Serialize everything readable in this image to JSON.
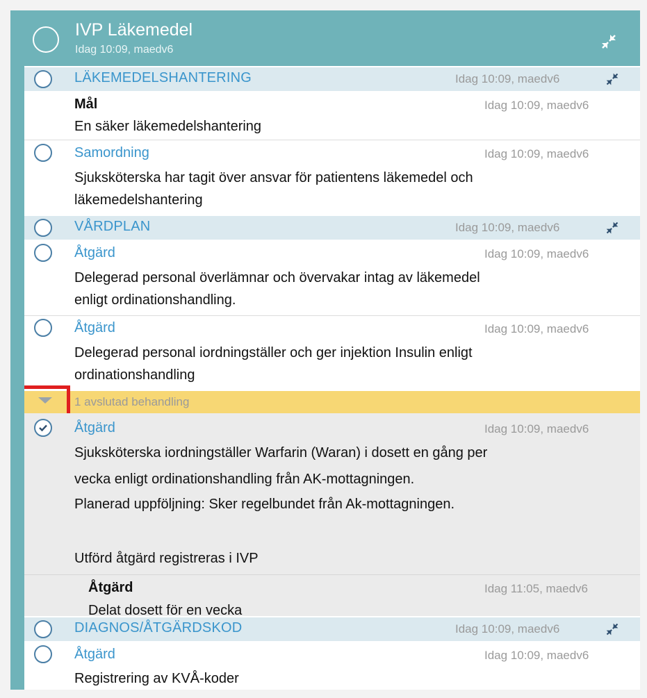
{
  "header": {
    "title": "IVP Läkemedel",
    "subtitle": "Idag 10:09, maedv6"
  },
  "sections": {
    "s1": {
      "label": "LÄKEMEDELSHANTERING",
      "meta": "Idag 10:09, maedv6"
    },
    "s2": {
      "label": "VÅRDPLAN",
      "meta": "Idag 10:09, maedv6"
    },
    "s3": {
      "label": "DIAGNOS/ÅTGÄRDSKOD",
      "meta": "Idag 10:09, maedv6"
    }
  },
  "entries": {
    "mal": {
      "title": "Mål",
      "meta": "Idag 10:09, maedv6",
      "text": "En säker läkemedelshantering"
    },
    "samordning": {
      "title": "Samordning",
      "meta": "Idag 10:09, maedv6",
      "line1": "Sjuksköterska har tagit över ansvar för patientens läkemedel och",
      "line2": "läkemedelshantering"
    },
    "atgard1": {
      "title": "Åtgärd",
      "meta": "Idag 10:09, maedv6",
      "line1": "Delegerad personal överlämnar och övervakar intag av läkemedel",
      "line2": "enligt ordinationshandling."
    },
    "atgard2": {
      "title": "Åtgärd",
      "meta": "Idag 10:09, maedv6",
      "line1": "Delegerad personal iordningställer och ger injektion Insulin enligt",
      "line2": "ordinationshandling"
    },
    "atgard3": {
      "title": "Åtgärd",
      "meta": "Idag 10:09, maedv6",
      "line1": "Sjuksköterska iordningställer Warfarin (Waran) i dosett en gång per",
      "line2": "vecka enligt ordinationshandling från AK-mottagningen.",
      "line3": "Planerad uppföljning: Sker regelbundet från Ak-mottagningen.",
      "line4": "Utförd åtgärd registreras i IVP"
    },
    "sub_atgard": {
      "title": "Åtgärd",
      "meta": "Idag 11:05, maedv6",
      "text": "Delat dosett för en vecka"
    },
    "atgard4": {
      "title": "Åtgärd",
      "meta": "Idag 10:09, maedv6",
      "text": "Registrering av KVÅ-koder"
    }
  },
  "closed": {
    "label": "1 avslutad behandling"
  },
  "icons": {
    "compress": "compress-arrows-icon",
    "expand": "triangle-down-icon",
    "check": "check-circle-icon",
    "status": "circle-icon"
  },
  "colors": {
    "teal": "#6fb3b9",
    "link": "#3a95cc",
    "section_bg": "#dbe9ef",
    "closed_band": "#f7d774",
    "highlight": "#e01f1f"
  }
}
